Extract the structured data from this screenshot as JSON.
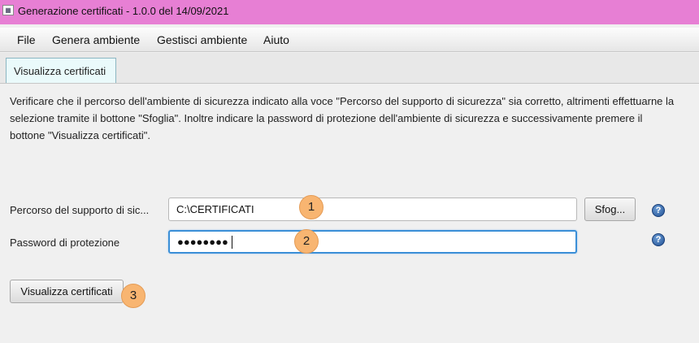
{
  "window": {
    "title": "Generazione certificati - 1.0.0 del 14/09/2021",
    "icon": "app-icon",
    "titlebar_color": "#e77fd4"
  },
  "menu": {
    "items": [
      "File",
      "Genera ambiente",
      "Gestisci ambiente",
      "Aiuto"
    ]
  },
  "tabs": [
    {
      "label": "Visualizza certificati",
      "selected": true
    }
  ],
  "description": "Verificare che il percorso dell'ambiente di sicurezza indicato alla voce \"Percorso del supporto di sicurezza\" sia corretto, altrimenti effettuarne la selezione tramite il bottone \"Sfoglia\". Inoltre indicare la password di protezione dell'ambiente di sicurezza e successivamente premere il bottone \"Visualizza certificati\".",
  "form": {
    "path_label": "Percorso del supporto di sic...",
    "path_value": "C:\\CERTIFICATI",
    "browse_label": "Sfog...",
    "password_label": "Password di protezione",
    "password_value": "●●●●●●●●",
    "submit_label": "Visualizza certificati",
    "help_glyph": "?"
  },
  "annotations": [
    "1",
    "2",
    "3"
  ],
  "colors": {
    "accent_focus": "#3b8fd7",
    "badge": "#f8b571",
    "help_icon": "#2a5ea8"
  }
}
